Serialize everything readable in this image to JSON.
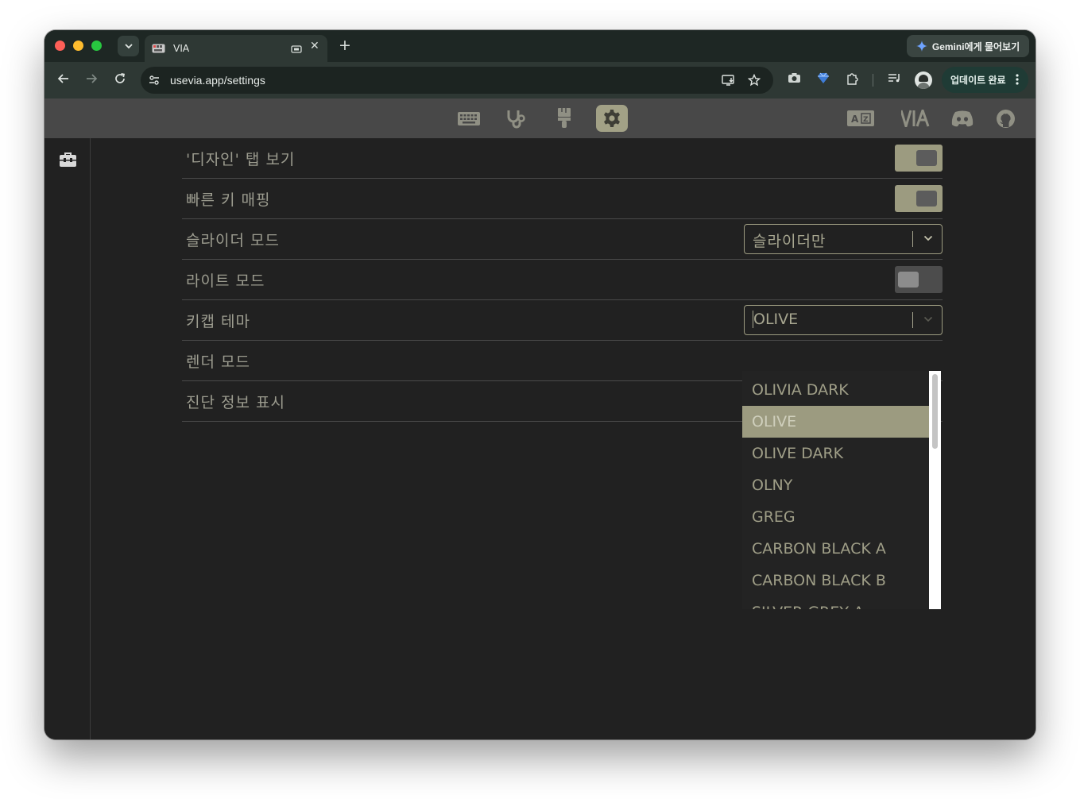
{
  "browser": {
    "tab_title": "VIA",
    "gemini_label": "Gemini에게 물어보기",
    "url": "usevia.app/settings",
    "update_label": "업데이트 완료"
  },
  "via_nav": {
    "brand": "VIA",
    "active_tab": "settings",
    "items": [
      "keyboard-icon",
      "stethoscope-icon",
      "paintbrush-icon",
      "gear-icon"
    ],
    "right_items": [
      "keycode-ab-icon",
      "via-logo",
      "discord-icon",
      "github-icon"
    ]
  },
  "settings": {
    "rows": [
      {
        "label": "'디자인' 탭 보기",
        "control": "toggle",
        "on": true
      },
      {
        "label": "빠른 키 매핑",
        "control": "toggle",
        "on": true
      },
      {
        "label": "슬라이더 모드",
        "control": "select",
        "value": "슬라이더만"
      },
      {
        "label": "라이트 모드",
        "control": "toggle",
        "on": false
      },
      {
        "label": "키캡 테마",
        "control": "select",
        "value": "OLIVE"
      },
      {
        "label": "렌더 모드",
        "control": "none"
      },
      {
        "label": "진단 정보 표시",
        "control": "none"
      }
    ]
  },
  "theme_dropdown": {
    "selected": "OLIVE",
    "options": [
      "OLIVIA DARK",
      "OLIVE",
      "OLIVE DARK",
      "OLNY",
      "GREG",
      "CARBON BLACK A",
      "CARBON BLACK B",
      "SILVER GREY A"
    ]
  },
  "colors": {
    "accent": "#9c9b80",
    "background": "#212121",
    "text_muted": "#9d9d90"
  }
}
